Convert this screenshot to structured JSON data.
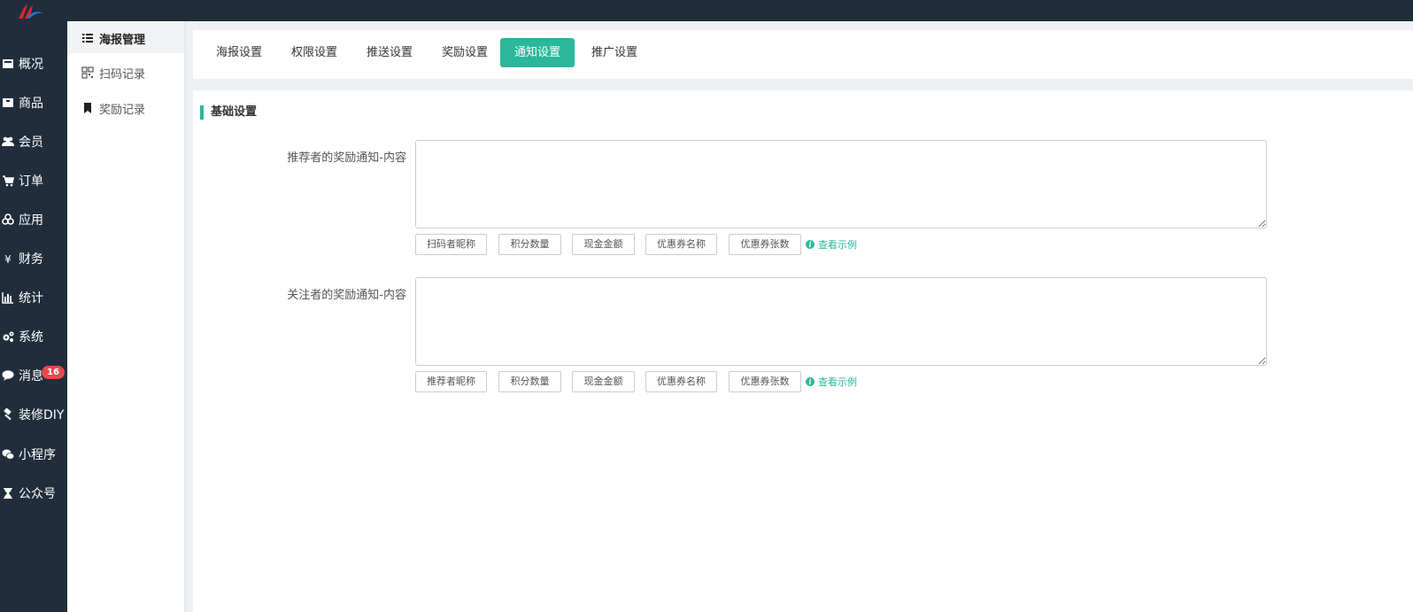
{
  "colors": {
    "accent": "#2ab79a",
    "sidebar_bg": "#212d3b",
    "badge": "#e8484f"
  },
  "sidebar": {
    "items": [
      {
        "label": "概况",
        "icon": "dashboard-icon"
      },
      {
        "label": "商品",
        "icon": "box-icon"
      },
      {
        "label": "会员",
        "icon": "users-icon"
      },
      {
        "label": "订单",
        "icon": "cart-icon"
      },
      {
        "label": "应用",
        "icon": "cubes-icon"
      },
      {
        "label": "财务",
        "icon": "yen-icon"
      },
      {
        "label": "统计",
        "icon": "bar-chart-icon"
      },
      {
        "label": "系统",
        "icon": "gears-icon"
      },
      {
        "label": "消息",
        "icon": "comment-icon",
        "badge": "16"
      },
      {
        "label": "装修DIY",
        "icon": "gavel-icon"
      },
      {
        "label": "小程序",
        "icon": "wechat-icon"
      },
      {
        "label": "公众号",
        "icon": "hourglass-icon"
      }
    ]
  },
  "subnav": {
    "items": [
      {
        "label": "海报管理",
        "icon": "list-icon",
        "active": true
      },
      {
        "label": "扫码记录",
        "icon": "qrcode-icon"
      },
      {
        "label": "奖励记录",
        "icon": "bookmark-icon"
      }
    ]
  },
  "tabs": [
    {
      "label": "海报设置"
    },
    {
      "label": "权限设置"
    },
    {
      "label": "推送设置"
    },
    {
      "label": "奖励设置"
    },
    {
      "label": "通知设置",
      "active": true
    },
    {
      "label": "推广设置"
    }
  ],
  "section_title": "基础设置",
  "fields": [
    {
      "label": "推荐者的奖励通知-内容",
      "value": "",
      "buttons": [
        "扫码者昵称",
        "积分数量",
        "现金金额",
        "优惠券名称",
        "优惠券张数"
      ],
      "example": "查看示例"
    },
    {
      "label": "关注者的奖励通知-内容",
      "value": "",
      "buttons": [
        "推荐者昵称",
        "积分数量",
        "现金金额",
        "优惠券名称",
        "优惠券张数"
      ],
      "example": "查看示例"
    }
  ]
}
